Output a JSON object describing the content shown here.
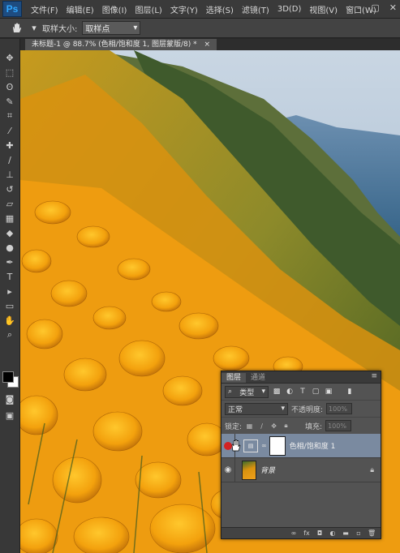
{
  "app": {
    "logo": "Ps"
  },
  "menu": [
    "文件(F)",
    "编辑(E)",
    "图像(I)",
    "图层(L)",
    "文字(Y)",
    "选择(S)",
    "滤镜(T)",
    "3D(D)",
    "视图(V)",
    "窗口(W)"
  ],
  "window_controls": [
    "–",
    "▢",
    "✕"
  ],
  "options": {
    "sample_size_label": "取样大小:",
    "sample_size_value": "取样点"
  },
  "document": {
    "tab_title": "未标题-1 @ 88.7% (色相/饱和度 1, 图层蒙版/8) *",
    "close": "×"
  },
  "layers_panel": {
    "tabs": [
      "图层",
      "通道"
    ],
    "filter_kind": "类型",
    "blend_mode": "正常",
    "opacity_label": "不透明度:",
    "opacity_value": "100%",
    "lock_label": "锁定:",
    "fill_label": "填充:",
    "fill_value": "100%",
    "layers": [
      {
        "name": "色相/饱和度 1",
        "selected": true
      },
      {
        "name": "背景",
        "selected": false
      }
    ],
    "footer_icons": [
      "link-icon",
      "fx-icon",
      "mask-icon",
      "adjustment-icon",
      "folder-icon",
      "new-layer-icon",
      "trash-icon"
    ]
  },
  "colors": {
    "foreground": "#000000",
    "background": "#ffffff",
    "selected_layer": "#7a8aa0"
  }
}
